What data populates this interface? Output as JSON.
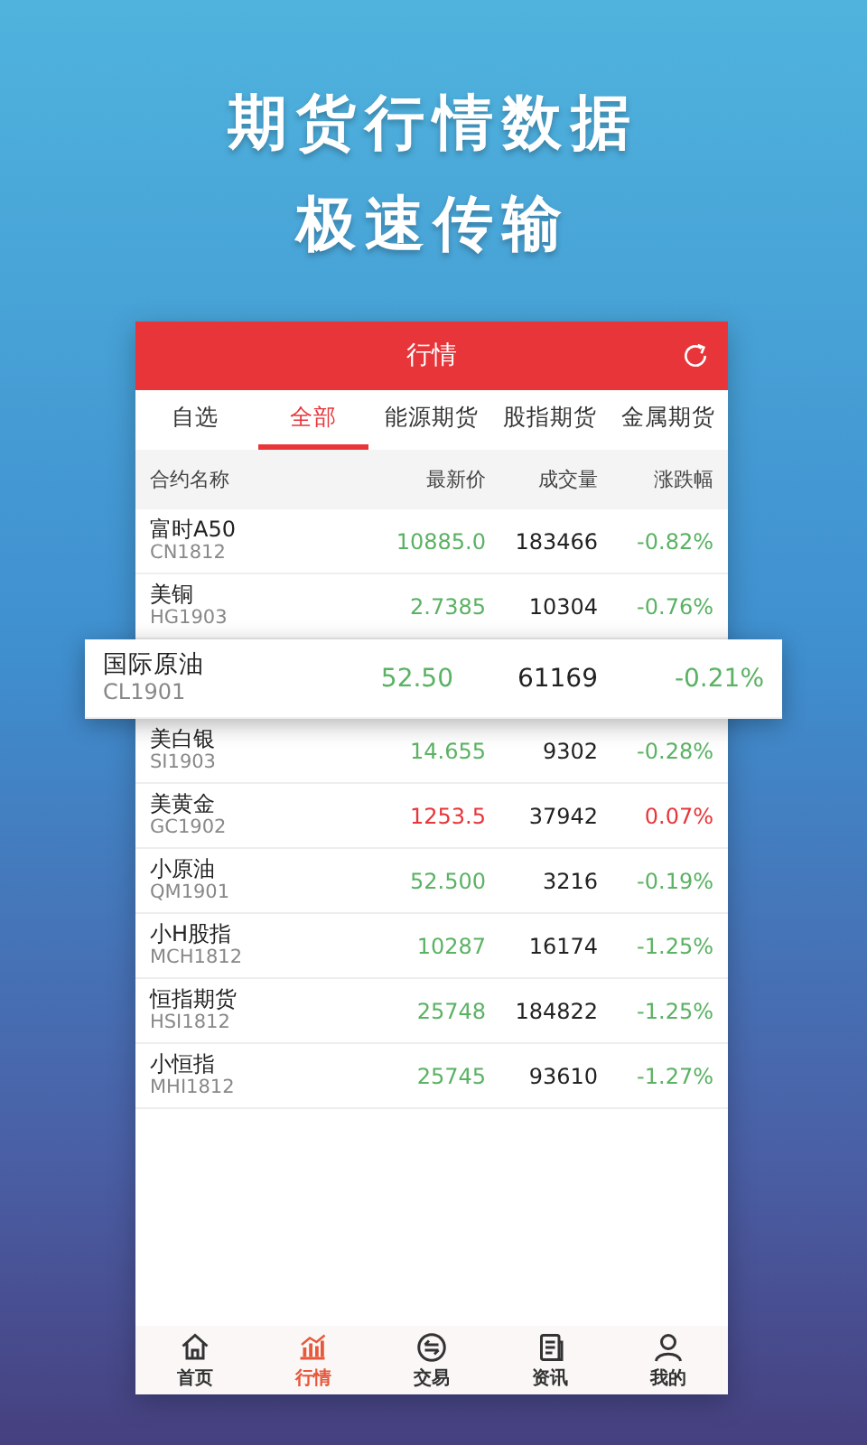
{
  "headline": [
    "期货行情数据",
    "极速传输"
  ],
  "screen": {
    "title": "行情",
    "tabs": [
      {
        "label": "自选",
        "selected": false
      },
      {
        "label": "全部",
        "selected": true
      },
      {
        "label": "能源期货",
        "selected": false
      },
      {
        "label": "股指期货",
        "selected": false
      },
      {
        "label": "金属期货",
        "selected": false
      }
    ],
    "columns": [
      "合约名称",
      "最新价",
      "成交量",
      "涨跌幅"
    ],
    "rows": [
      {
        "name": "富时A50",
        "code": "CN1812",
        "price": "10885.0",
        "volume": "183466",
        "change": "-0.82%",
        "color": "#5ab263",
        "highlighted": false
      },
      {
        "name": "美铜",
        "code": "HG1903",
        "price": "2.7385",
        "volume": "10304",
        "change": "-0.76%",
        "color": "#5ab263",
        "highlighted": false
      },
      {
        "name": "国际原油",
        "code": "CL1901",
        "price": "52.50",
        "volume": "61169",
        "change": "-0.21%",
        "color": "#5ab263",
        "highlighted": true
      },
      {
        "name": "美白银",
        "code": "SI1903",
        "price": "14.655",
        "volume": "9302",
        "change": "-0.28%",
        "color": "#5ab263",
        "highlighted": false
      },
      {
        "name": "美黄金",
        "code": "GC1902",
        "price": "1253.5",
        "volume": "37942",
        "change": "0.07%",
        "color": "#e8353a",
        "highlighted": false
      },
      {
        "name": "小原油",
        "code": "QM1901",
        "price": "52.500",
        "volume": "3216",
        "change": "-0.19%",
        "color": "#5ab263",
        "highlighted": false
      },
      {
        "name": "小H股指",
        "code": "MCH1812",
        "price": "10287",
        "volume": "16174",
        "change": "-1.25%",
        "color": "#5ab263",
        "highlighted": false
      },
      {
        "name": "恒指期货",
        "code": "HSI1812",
        "price": "25748",
        "volume": "184822",
        "change": "-1.25%",
        "color": "#5ab263",
        "highlighted": false
      },
      {
        "name": "小恒指",
        "code": "MHI1812",
        "price": "25745",
        "volume": "93610",
        "change": "-1.27%",
        "color": "#5ab263",
        "highlighted": false
      }
    ],
    "nav": [
      {
        "label": "首页",
        "kind": "home",
        "selected": false
      },
      {
        "label": "行情",
        "kind": "chart",
        "selected": true
      },
      {
        "label": "交易",
        "kind": "exchange",
        "selected": false
      },
      {
        "label": "资讯",
        "kind": "news",
        "selected": false
      },
      {
        "label": "我的",
        "kind": "user",
        "selected": false
      }
    ]
  }
}
